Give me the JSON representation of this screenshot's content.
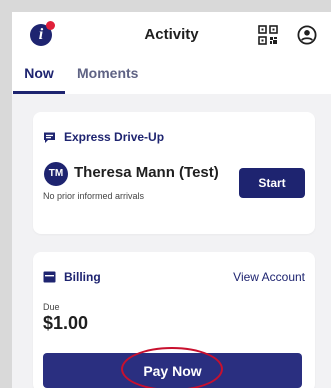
{
  "header": {
    "title": "Activity",
    "info_icon": "info-icon",
    "info_letter": "i",
    "qr_icon": "qr-code-icon",
    "profile_icon": "profile-icon"
  },
  "tabs": [
    {
      "label": "Now",
      "active": true
    },
    {
      "label": "Moments",
      "active": false
    }
  ],
  "express": {
    "heading": "Express Drive-Up",
    "icon": "chat-icon",
    "avatar_initials": "TM",
    "name": "Theresa Mann (Test)",
    "subtext": "No prior informed arrivals",
    "start_label": "Start"
  },
  "billing": {
    "heading": "Billing",
    "icon": "wallet-icon",
    "view_account_label": "View Account",
    "due_label": "Due",
    "due_amount": "$1.00",
    "pay_label": "Pay Now"
  },
  "colors": {
    "brand": "#1e2470",
    "alert": "#e0203a",
    "annotation": "#c8102e",
    "background": "#f2f2f4"
  }
}
